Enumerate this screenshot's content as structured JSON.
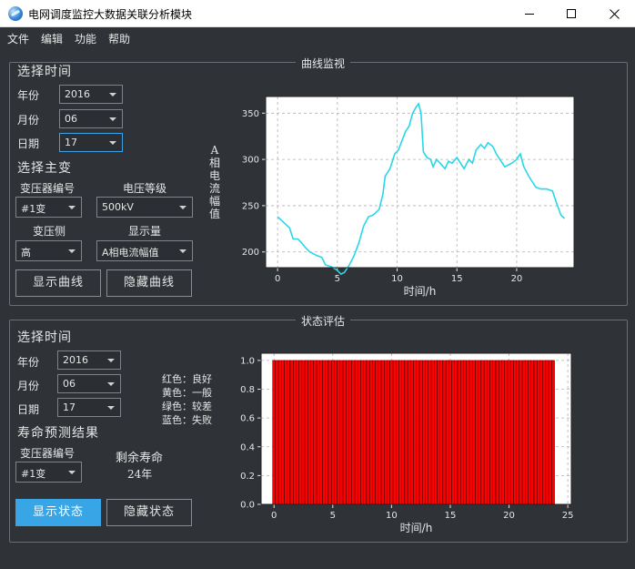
{
  "window": {
    "title": "电网调度监控大数据关联分析模块"
  },
  "menu": [
    "文件",
    "编辑",
    "功能",
    "帮助"
  ],
  "curve_panel": {
    "group_title": "曲线监视",
    "time_section_title": "选择时间",
    "year_label": "年份",
    "year_value": "2016",
    "month_label": "月份",
    "month_value": "06",
    "day_label": "日期",
    "day_value": "17",
    "transformer_section_title": "选择主变",
    "transformer_id_label": "变压器编号",
    "transformer_id_value": "#1变",
    "voltage_label": "电压等级",
    "voltage_value": "500kV",
    "side_label": "变压侧",
    "side_value": "高",
    "quantity_label": "显示量",
    "quantity_value": "A相电流幅值",
    "show_button": "显示曲线",
    "hide_button": "隐藏曲线",
    "chart_ylabel": "A相电流幅值"
  },
  "state_panel": {
    "group_title": "状态评估",
    "time_section_title": "选择时间",
    "year_label": "年份",
    "year_value": "2016",
    "month_label": "月份",
    "month_value": "06",
    "day_label": "日期",
    "day_value": "17",
    "life_section_title": "寿命预测结果",
    "transformer_id_label": "变压器编号",
    "transformer_id_value": "#1变",
    "remaining_life_label": "剩余寿命",
    "remaining_life_value": "24年",
    "legend_notes": [
      "红色：良好",
      "黄色：一般",
      "绿色：较差",
      "蓝色：失败"
    ],
    "show_button": "显示状态",
    "hide_button": "隐藏状态"
  },
  "colors": {
    "accent": "#38a6e6",
    "curve": "#27d7e8",
    "bar": "#ff0000",
    "bar_edge": "#000000",
    "plot_bg": "#ffffff"
  },
  "chart_data": [
    {
      "type": "line",
      "title": "",
      "xlabel": "时间/h",
      "ylabel": "A相电流幅值",
      "xlim": [
        -1,
        24.8
      ],
      "ylim": [
        183,
        368
      ],
      "xticks": [
        0,
        5,
        10,
        15,
        20
      ],
      "yticks": [
        200,
        250,
        300,
        350
      ],
      "grid": true,
      "series": [
        {
          "points": [
            [
              0,
              238
            ],
            [
              0.5,
              232
            ],
            [
              1,
              226
            ],
            [
              1.3,
              214
            ],
            [
              1.7,
              214
            ],
            [
              2,
              210
            ],
            [
              2.3,
              205
            ],
            [
              2.7,
              200
            ],
            [
              3,
              198
            ],
            [
              3.3,
              196
            ],
            [
              3.7,
              194
            ],
            [
              4,
              186
            ],
            [
              4.5,
              184
            ],
            [
              5,
              180
            ],
            [
              5.3,
              176
            ],
            [
              5.6,
              178
            ],
            [
              6,
              186
            ],
            [
              6.4,
              196
            ],
            [
              6.8,
              210
            ],
            [
              7.2,
              228
            ],
            [
              7.6,
              238
            ],
            [
              8,
              240
            ],
            [
              8.5,
              246
            ],
            [
              8.8,
              262
            ],
            [
              9,
              282
            ],
            [
              9.4,
              290
            ],
            [
              9.8,
              306
            ],
            [
              10.1,
              310
            ],
            [
              10.4,
              320
            ],
            [
              10.7,
              330
            ],
            [
              11,
              336
            ],
            [
              11.3,
              350
            ],
            [
              11.6,
              357
            ],
            [
              11.8,
              360
            ],
            [
              12,
              350
            ],
            [
              12.2,
              308
            ],
            [
              12.5,
              302
            ],
            [
              12.8,
              300
            ],
            [
              13,
              292
            ],
            [
              13.3,
              300
            ],
            [
              13.6,
              296
            ],
            [
              14,
              290
            ],
            [
              14.3,
              298
            ],
            [
              14.6,
              296
            ],
            [
              15,
              302
            ],
            [
              15.3,
              296
            ],
            [
              15.6,
              290
            ],
            [
              16,
              300
            ],
            [
              16.3,
              296
            ],
            [
              16.6,
              310
            ],
            [
              17,
              316
            ],
            [
              17.3,
              312
            ],
            [
              17.6,
              318
            ],
            [
              18,
              314
            ],
            [
              18.3,
              306
            ],
            [
              18.6,
              300
            ],
            [
              19,
              292
            ],
            [
              19.3,
              294
            ],
            [
              19.6,
              296
            ],
            [
              20,
              300
            ],
            [
              20.3,
              306
            ],
            [
              20.6,
              292
            ],
            [
              21,
              282
            ],
            [
              21.3,
              276
            ],
            [
              21.6,
              270
            ],
            [
              22,
              268
            ],
            [
              22.5,
              268
            ],
            [
              23,
              266
            ],
            [
              23.3,
              254
            ],
            [
              23.7,
              240
            ],
            [
              24,
              236
            ]
          ]
        }
      ]
    },
    {
      "type": "bar",
      "title": "",
      "xlabel": "时间/h",
      "ylabel": "",
      "xlim": [
        -1.1,
        25.3
      ],
      "ylim": [
        0,
        1.05
      ],
      "xticks": [
        0,
        5,
        10,
        15,
        20,
        25
      ],
      "yticks": [
        0.0,
        0.2,
        0.4,
        0.6,
        0.8,
        1.0
      ],
      "grid": true,
      "bar_count": 96,
      "bar_start": 0,
      "bar_step": 0.25,
      "value": 1.0
    }
  ]
}
